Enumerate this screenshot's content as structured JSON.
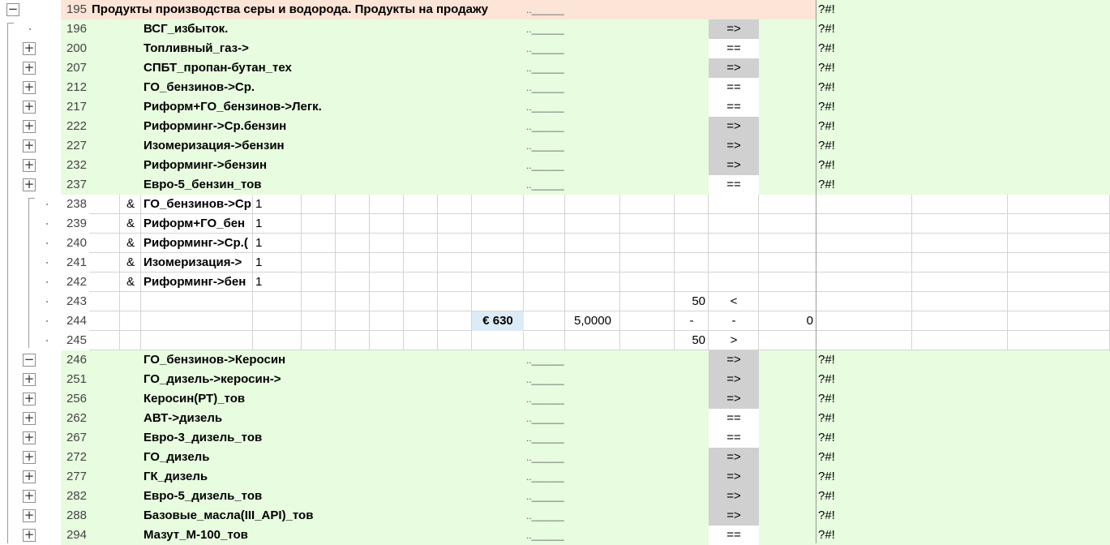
{
  "outline": {
    "expand_symbol": "+",
    "collapse_symbol": "−"
  },
  "rows": [
    {
      "num": "195",
      "kind": "header",
      "ctrl": "minus",
      "title": "Продукты производства серы и водорода. Продукты на продажу",
      "dots": "..______",
      "flag": "?#!"
    },
    {
      "num": "196",
      "kind": "product",
      "ctrl": "dot",
      "name": "ВСГ_избыток.",
      "dots": "..______",
      "op": "=>",
      "flag": "?#!"
    },
    {
      "num": "200",
      "kind": "product",
      "ctrl": "plus",
      "name": "Топливный_газ->",
      "dots": "..______",
      "op": "==",
      "flag": "?#!"
    },
    {
      "num": "207",
      "kind": "product",
      "ctrl": "plus",
      "name": "СПБТ_пропан-бутан_тех",
      "dots": "..______",
      "op": "=>",
      "flag": "?#!"
    },
    {
      "num": "212",
      "kind": "product",
      "ctrl": "plus",
      "name": "ГО_бензинов->Ср.",
      "dots": "..______",
      "op": "==",
      "flag": "?#!"
    },
    {
      "num": "217",
      "kind": "product",
      "ctrl": "plus",
      "name": "Риформ+ГО_бензинов->Легк.",
      "dots": "..______",
      "op": "==",
      "flag": "?#!"
    },
    {
      "num": "222",
      "kind": "product",
      "ctrl": "plus",
      "name": "Риформинг->Ср.бензин",
      "dots": "..______",
      "op": "=>",
      "flag": "?#!"
    },
    {
      "num": "227",
      "kind": "product",
      "ctrl": "plus",
      "name": "Изомеризация->бензин",
      "dots": "..______",
      "op": "=>",
      "flag": "?#!"
    },
    {
      "num": "232",
      "kind": "product",
      "ctrl": "plus",
      "name": "Риформинг->бензин",
      "dots": "..______",
      "op": "=>",
      "flag": "?#!"
    },
    {
      "num": "237",
      "kind": "product",
      "ctrl": "plus",
      "name": "Евро-5_бензин_тов",
      "dots": "..______",
      "op": "==",
      "flag": "?#!"
    },
    {
      "num": "238",
      "kind": "detail",
      "ctrl": "dot",
      "amp": "&",
      "name": "ГО_бензинов->Ср",
      "val": "1"
    },
    {
      "num": "239",
      "kind": "detail",
      "ctrl": "dot",
      "amp": "&",
      "name": "Риформ+ГО_бен",
      "val": "1"
    },
    {
      "num": "240",
      "kind": "detail",
      "ctrl": "dot",
      "amp": "&",
      "name": "Риформинг->Ср.(",
      "val": "1"
    },
    {
      "num": "241",
      "kind": "detail",
      "ctrl": "dot",
      "amp": "&",
      "name": "Изомеризация->",
      "val": "1"
    },
    {
      "num": "242",
      "kind": "detail",
      "ctrl": "dot",
      "amp": "&",
      "name": "Риформинг->бен",
      "val": "1"
    },
    {
      "num": "243",
      "kind": "limit",
      "ctrl": "dot",
      "qty": "50",
      "op": "<"
    },
    {
      "num": "244",
      "kind": "value",
      "ctrl": "dot",
      "price": "€ 630",
      "coef": "5,0000",
      "d1": "-",
      "d2": "-",
      "total": "0"
    },
    {
      "num": "245",
      "kind": "limit",
      "ctrl": "dot",
      "qty": "50",
      "op": ">"
    },
    {
      "num": "246",
      "kind": "product",
      "ctrl": "minus",
      "name": "ГО_бензинов->Керосин",
      "dots": "..______",
      "op": "=>",
      "flag": "?#!"
    },
    {
      "num": "251",
      "kind": "product",
      "ctrl": "plus",
      "name": "ГО_дизель->керосин->",
      "dots": "..______",
      "op": "=>",
      "flag": "?#!"
    },
    {
      "num": "256",
      "kind": "product",
      "ctrl": "plus",
      "name": "Керосин(РТ)_тов",
      "dots": "..______",
      "op": "=>",
      "flag": "?#!"
    },
    {
      "num": "262",
      "kind": "product",
      "ctrl": "plus",
      "name": "АВТ->дизель",
      "dots": "..______",
      "op": "==",
      "flag": "?#!"
    },
    {
      "num": "267",
      "kind": "product",
      "ctrl": "plus",
      "name": "Евро-3_дизель_тов",
      "dots": "..______",
      "op": "==",
      "flag": "?#!"
    },
    {
      "num": "272",
      "kind": "product",
      "ctrl": "plus",
      "name": "ГО_дизель",
      "dots": "..______",
      "op": "=>",
      "flag": "?#!"
    },
    {
      "num": "277",
      "kind": "product",
      "ctrl": "plus",
      "name": "ГК_дизель",
      "dots": "..______",
      "op": "=>",
      "flag": "?#!"
    },
    {
      "num": "282",
      "kind": "product",
      "ctrl": "plus",
      "name": "Евро-5_дизель_тов",
      "dots": "..______",
      "op": "=>",
      "flag": "?#!"
    },
    {
      "num": "288",
      "kind": "product",
      "ctrl": "plus",
      "name": "Базовые_масла(III_API)_тов",
      "dots": "..______",
      "op": "=>",
      "flag": "?#!"
    },
    {
      "num": "294",
      "kind": "product",
      "ctrl": "plus",
      "name": "Мазут_М-100_тов",
      "dots": "..______",
      "op": "==",
      "flag": "?#!"
    }
  ]
}
